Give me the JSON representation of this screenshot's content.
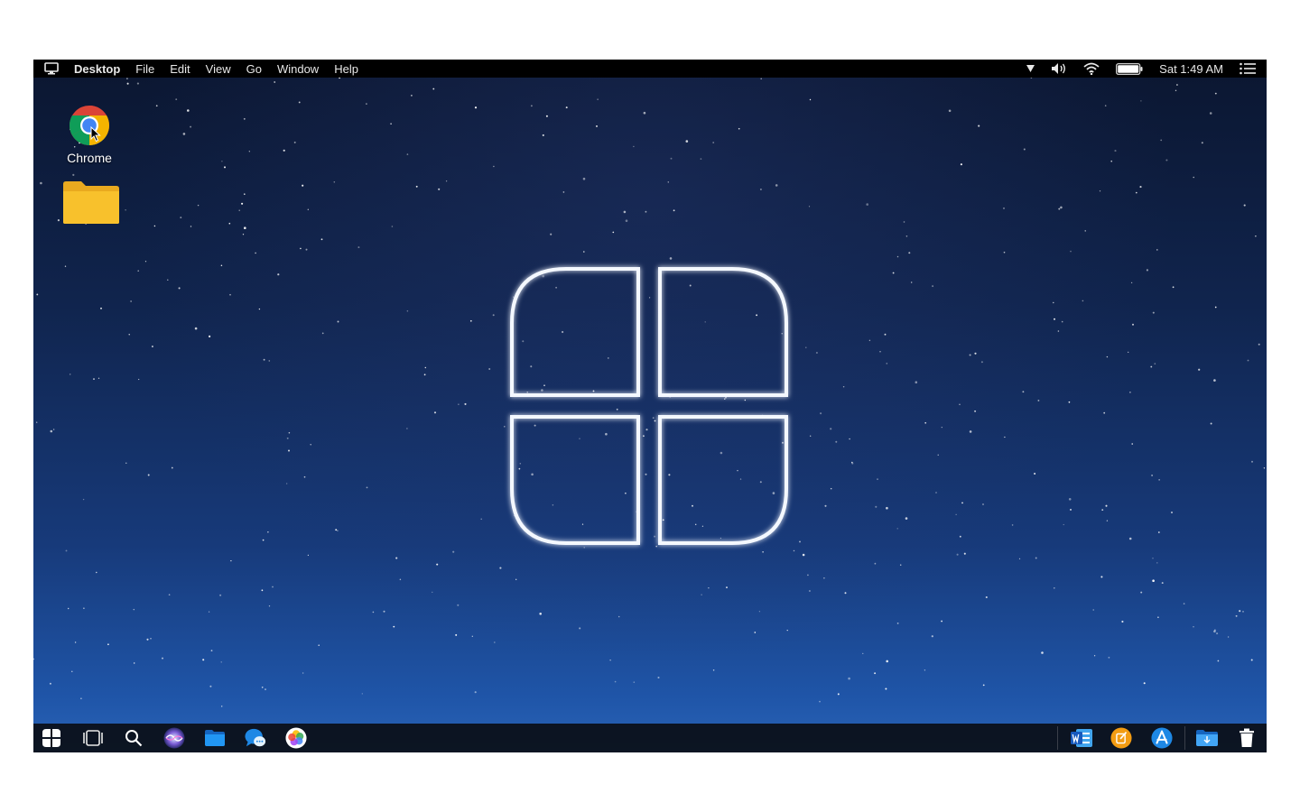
{
  "menubar": {
    "app_name": "Desktop",
    "menus": [
      "File",
      "Edit",
      "View",
      "Go",
      "Window",
      "Help"
    ],
    "clock": "Sat 1:49 AM",
    "battery_level": 1.0
  },
  "desktop": {
    "icons": [
      {
        "label": "Chrome",
        "icon": "chrome-icon"
      },
      {
        "label": "",
        "icon": "folder-icon"
      }
    ]
  },
  "dock": {
    "left_items": [
      "start-icon",
      "task-view-icon",
      "search-icon",
      "siri-icon",
      "files-icon",
      "messages-icon",
      "photos-icon"
    ],
    "right_items": [
      "word-icon",
      "pages-icon",
      "app-store-icon",
      "downloads-folder-icon",
      "trash-icon"
    ]
  },
  "colors": {
    "accent": "#1e88e5",
    "folder": "#f8c12c",
    "menubar": "#000000"
  }
}
